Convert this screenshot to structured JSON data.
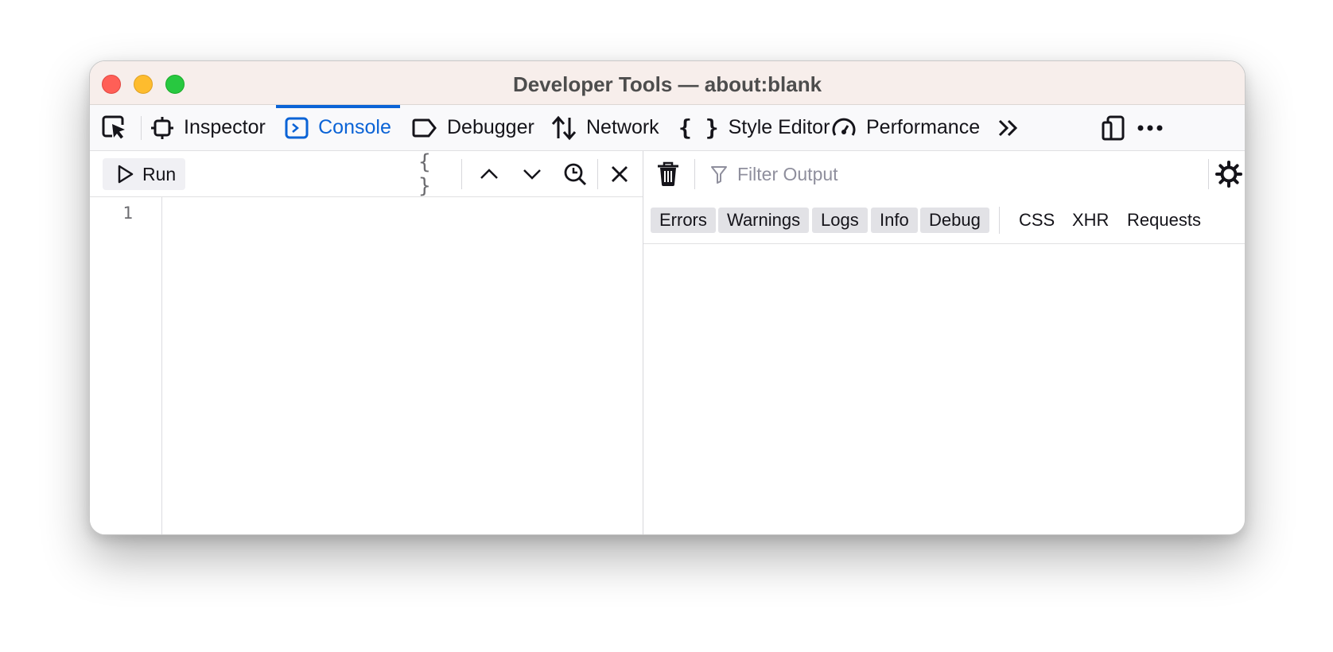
{
  "window": {
    "title": "Developer Tools — about:blank"
  },
  "toolbar": {
    "tabs": [
      {
        "label": "Inspector",
        "icon": "inspector-icon"
      },
      {
        "label": "Console",
        "icon": "console-icon",
        "active": true
      },
      {
        "label": "Debugger",
        "icon": "debugger-icon"
      },
      {
        "label": "Network",
        "icon": "network-arrows-icon"
      },
      {
        "label": "Style Editor",
        "icon": "braces-icon"
      },
      {
        "label": "Performance",
        "icon": "gauge-icon"
      }
    ],
    "active_color": "#0b63d6"
  },
  "editor": {
    "run_label": "Run",
    "line_numbers": [
      "1"
    ]
  },
  "output": {
    "filter_placeholder": "Filter Output",
    "level_filters": [
      {
        "label": "Errors",
        "enabled": true
      },
      {
        "label": "Warnings",
        "enabled": true
      },
      {
        "label": "Logs",
        "enabled": true
      },
      {
        "label": "Info",
        "enabled": true
      },
      {
        "label": "Debug",
        "enabled": true
      }
    ],
    "type_filters": [
      {
        "label": "CSS",
        "enabled": false
      },
      {
        "label": "XHR",
        "enabled": false
      },
      {
        "label": "Requests",
        "enabled": false
      }
    ]
  }
}
